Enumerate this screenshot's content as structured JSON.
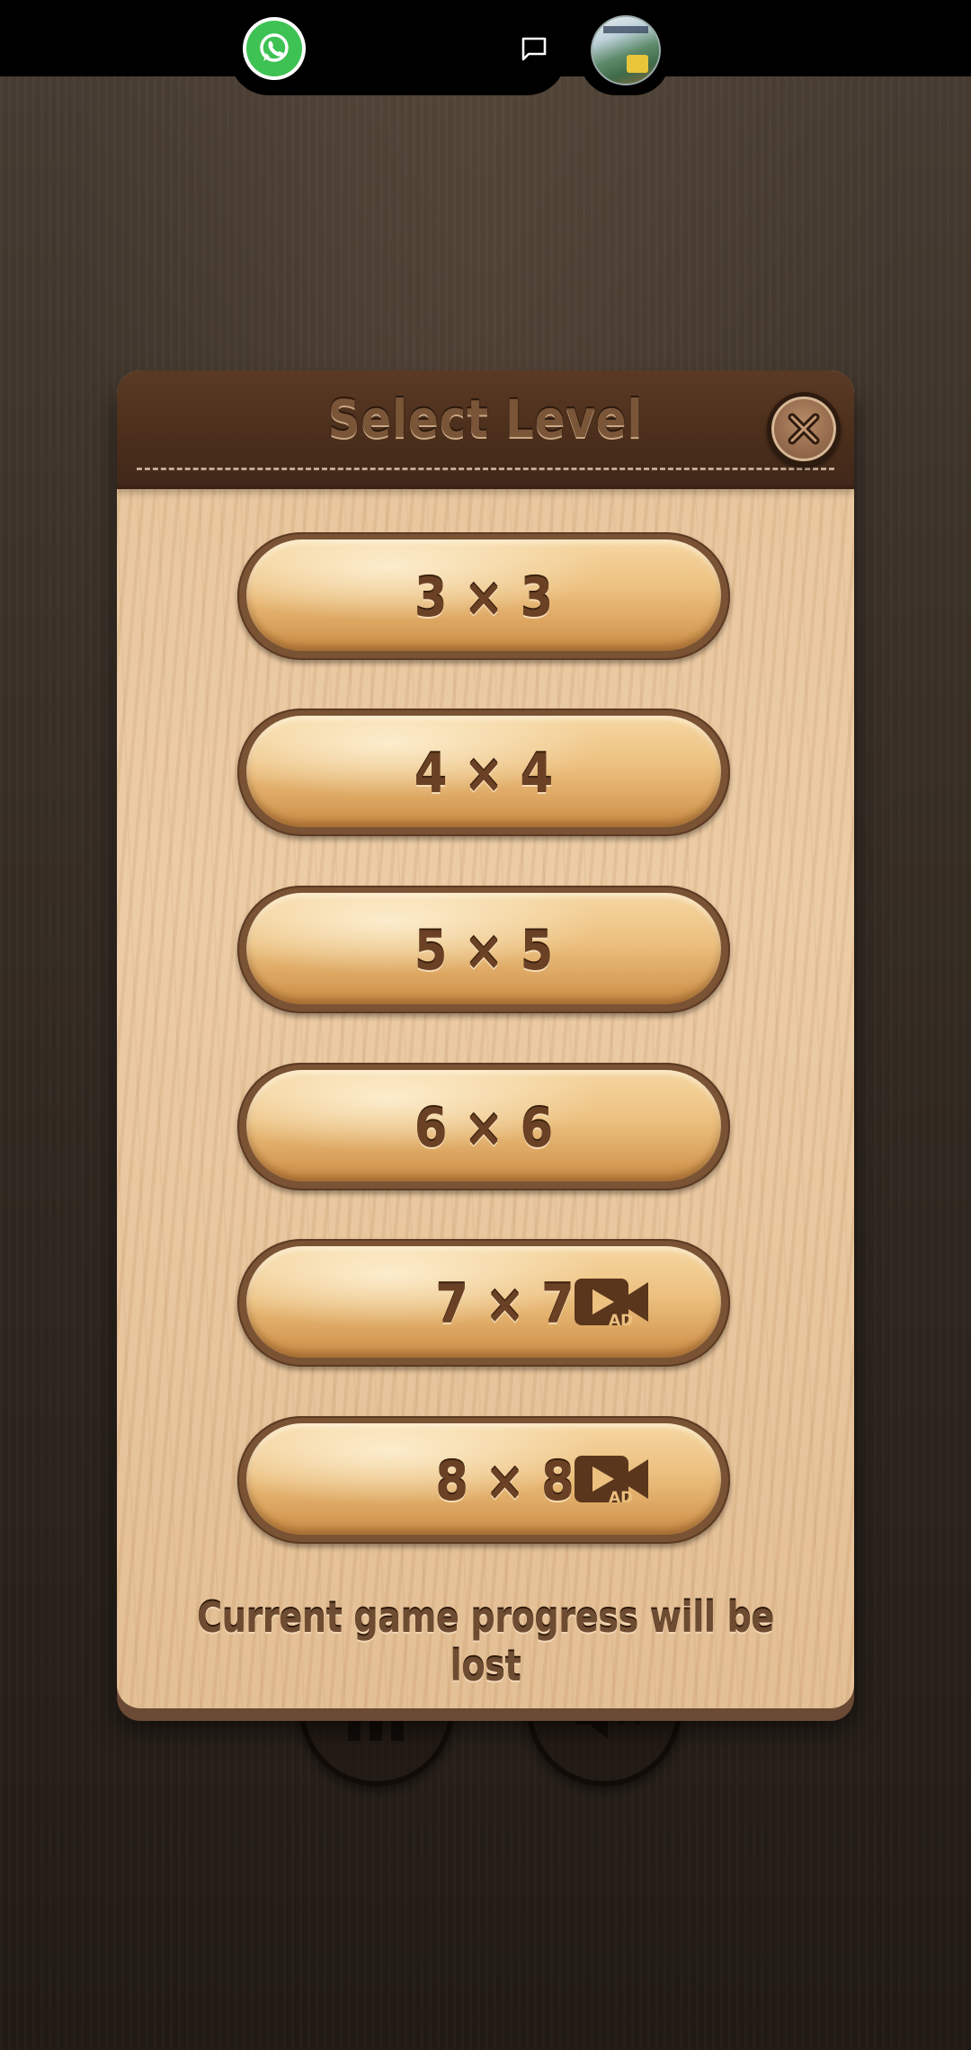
{
  "dialog": {
    "title": "Select Level",
    "close_icon": "close-x-icon",
    "levels": [
      {
        "label": "3 × 3",
        "ad_required": false
      },
      {
        "label": "4 × 4",
        "ad_required": false
      },
      {
        "label": "5 × 5",
        "ad_required": false
      },
      {
        "label": "6 × 6",
        "ad_required": false
      },
      {
        "label": "7 × 7",
        "ad_required": true,
        "ad_icon": "video-ad-icon",
        "ad_badge": "AD"
      },
      {
        "label": "8 × 8",
        "ad_required": true,
        "ad_icon": "video-ad-icon",
        "ad_badge": "AD"
      }
    ],
    "warning": "Current game progress will be lost"
  },
  "status_bar": {
    "icons": [
      "whatsapp-icon",
      "chat-bubble-icon",
      "profile-avatar"
    ]
  },
  "background_buttons": [
    "leaderboard-icon",
    "sound-muted-icon"
  ],
  "colors": {
    "header_leather": "#4a2e1b",
    "panel_wood": "#e7c49b",
    "button_wood": "#ecc07f",
    "text_brown": "#6a4124",
    "whatsapp_green": "#3ec253"
  }
}
